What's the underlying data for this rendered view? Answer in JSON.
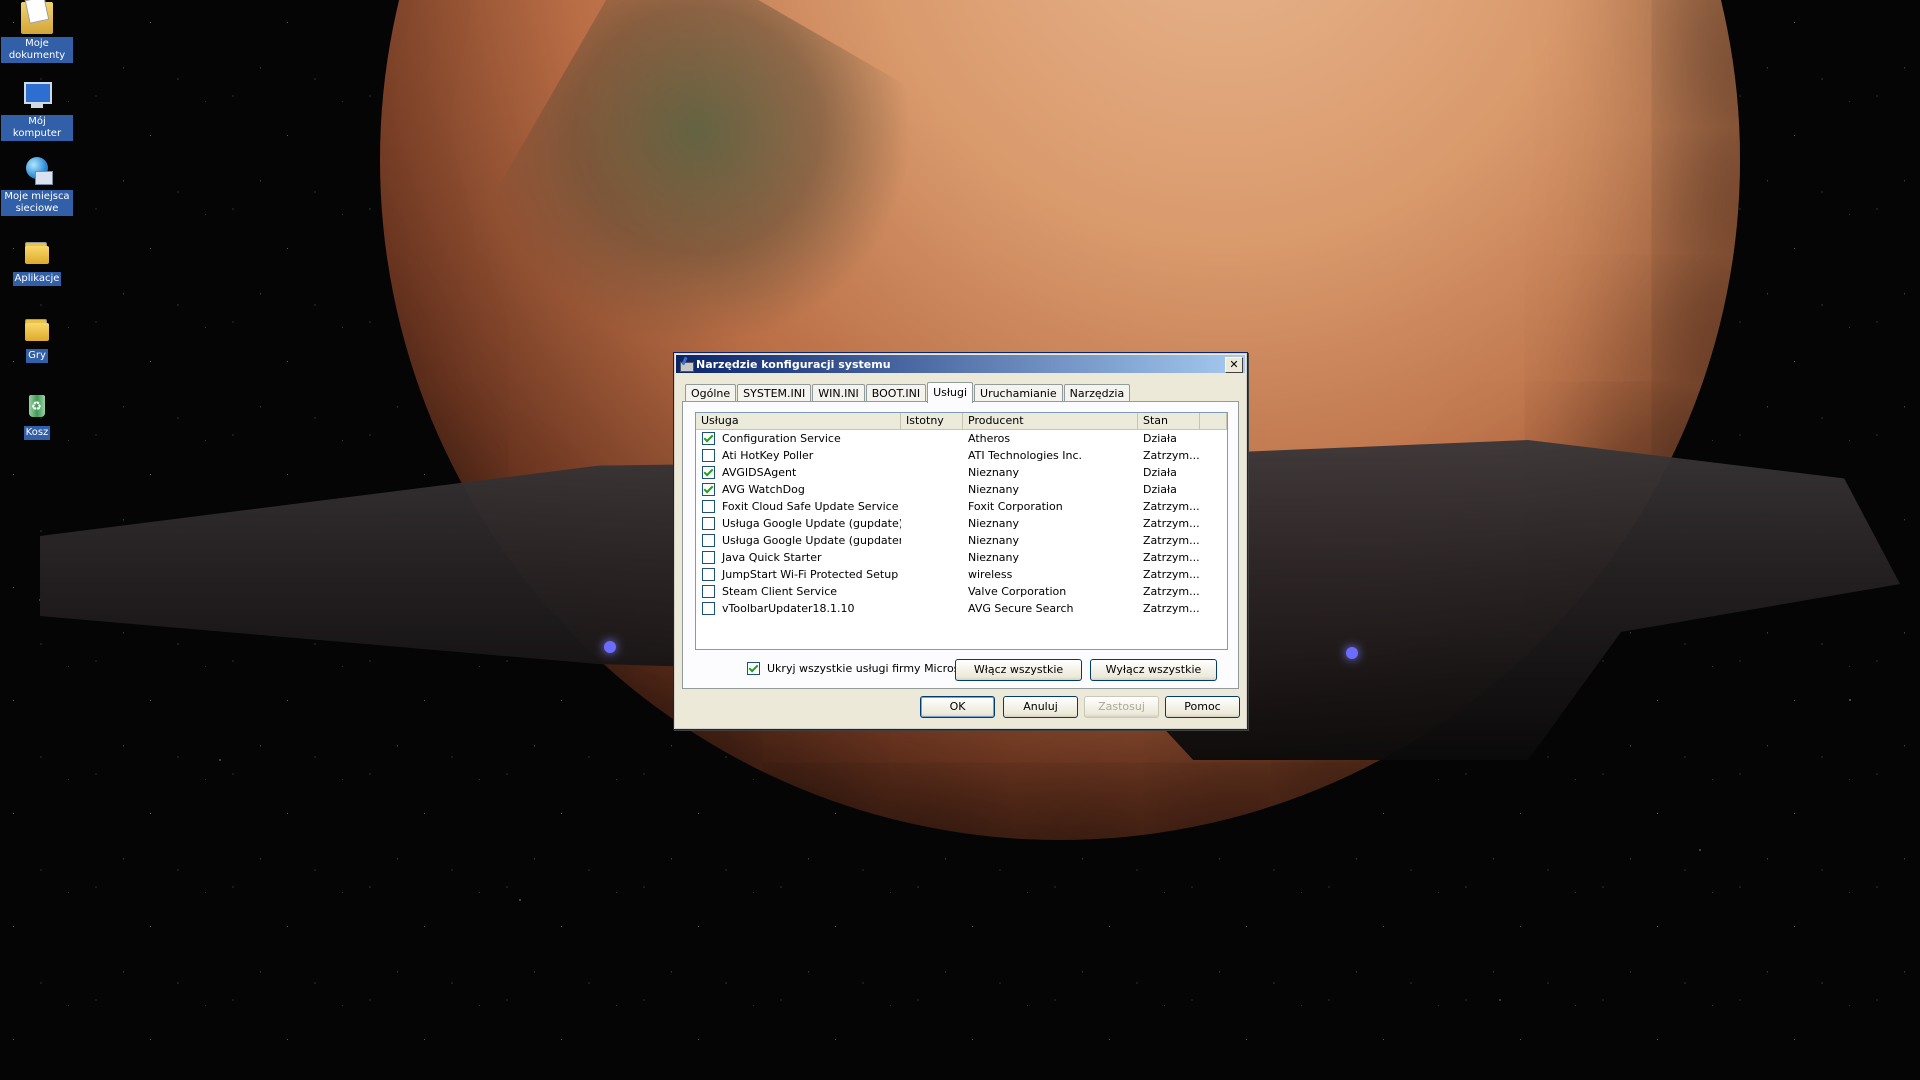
{
  "desktop": {
    "icons": [
      {
        "label": "Moje dokumenty",
        "icon": "my-documents-icon"
      },
      {
        "label": "Mój komputer",
        "icon": "my-computer-icon"
      },
      {
        "label": "Moje miejsca sieciowe",
        "icon": "network-places-icon"
      },
      {
        "label": "Aplikacje",
        "icon": "folder-icon"
      },
      {
        "label": "Gry",
        "icon": "folder-icon"
      },
      {
        "label": "Kosz",
        "icon": "recycle-bin-icon"
      }
    ]
  },
  "dialog": {
    "title": "Narzędzie konfiguracji systemu",
    "close": "✕",
    "tabs": [
      {
        "label": "Ogólne",
        "active": false
      },
      {
        "label": "SYSTEM.INI",
        "active": false
      },
      {
        "label": "WIN.INI",
        "active": false
      },
      {
        "label": "BOOT.INI",
        "active": false
      },
      {
        "label": "Usługi",
        "active": true
      },
      {
        "label": "Uruchamianie",
        "active": false
      },
      {
        "label": "Narzędzia",
        "active": false
      }
    ],
    "columns": [
      "Usługa",
      "Istotny",
      "Producent",
      "Stan",
      ""
    ],
    "services": [
      {
        "name": "Configuration Service",
        "essential": "",
        "manufacturer": "Atheros",
        "status": "Działa",
        "checked": true
      },
      {
        "name": "Ati HotKey Poller",
        "essential": "",
        "manufacturer": "ATI Technologies Inc.",
        "status": "Zatrzym...",
        "checked": false
      },
      {
        "name": "AVGIDSAgent",
        "essential": "",
        "manufacturer": "Nieznany",
        "status": "Działa",
        "checked": true
      },
      {
        "name": "AVG WatchDog",
        "essential": "",
        "manufacturer": "Nieznany",
        "status": "Działa",
        "checked": true
      },
      {
        "name": "Foxit Cloud Safe Update Service",
        "essential": "",
        "manufacturer": "Foxit Corporation",
        "status": "Zatrzym...",
        "checked": false
      },
      {
        "name": "Usługa Google Update (gupdate)",
        "essential": "",
        "manufacturer": "Nieznany",
        "status": "Zatrzym...",
        "checked": false
      },
      {
        "name": "Usługa Google Update (gupdatem)",
        "essential": "",
        "manufacturer": "Nieznany",
        "status": "Zatrzym...",
        "checked": false
      },
      {
        "name": "Java Quick Starter",
        "essential": "",
        "manufacturer": "Nieznany",
        "status": "Zatrzym...",
        "checked": false
      },
      {
        "name": "JumpStart Wi-Fi Protected Setup",
        "essential": "",
        "manufacturer": "wireless",
        "status": "Zatrzym...",
        "checked": false
      },
      {
        "name": "Steam Client Service",
        "essential": "",
        "manufacturer": "Valve Corporation",
        "status": "Zatrzym...",
        "checked": false
      },
      {
        "name": "vToolbarUpdater18.1.10",
        "essential": "",
        "manufacturer": "AVG Secure Search",
        "status": "Zatrzym...",
        "checked": false
      }
    ],
    "hide_ms_label": "Ukryj wszystkie usługi firmy Microsoft",
    "hide_ms_checked": true,
    "enable_all_label": "Włącz wszystkie",
    "disable_all_label": "Wyłącz wszystkie",
    "ok_label": "OK",
    "cancel_label": "Anuluj",
    "apply_label": "Zastosuj",
    "help_label": "Pomoc"
  }
}
